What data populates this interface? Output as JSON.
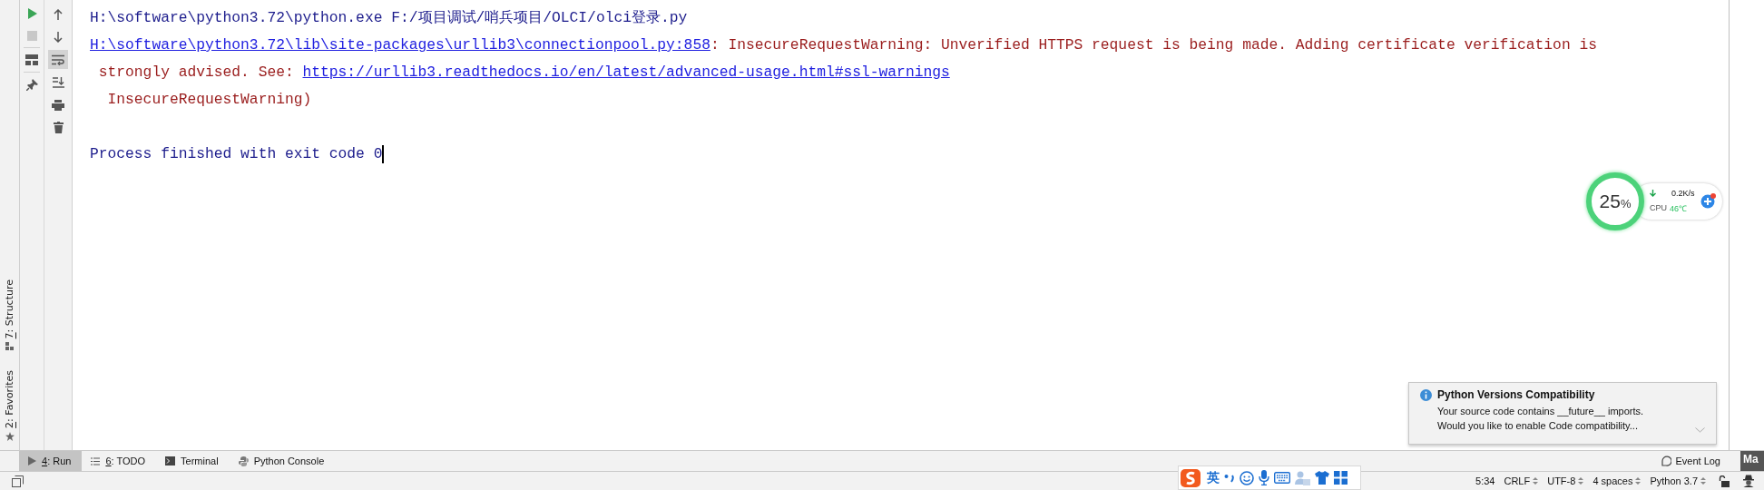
{
  "side_tabs": [
    {
      "mnemonic": "7",
      "label": ": Structure"
    },
    {
      "mnemonic": "2",
      "label": ": Favorites"
    }
  ],
  "run_toolbar": [
    {
      "enabled": true
    },
    {
      "enabled": false
    }
  ],
  "console_toolbar": [
    {
      "selected": false
    },
    {
      "selected": false
    },
    {
      "selected": true
    },
    {
      "selected": false
    },
    {
      "selected": false
    },
    {
      "selected": false
    }
  ],
  "console": {
    "lines": [
      [
        {
          "kind": "plain",
          "text": "H:\\software\\python3.72\\python.exe F:/项目调试/哨兵项目/OLCI/olci登录.py"
        }
      ],
      [
        {
          "kind": "link",
          "text": "H:\\software\\python3.72\\lib\\site-packages\\urllib3\\connectionpool.py:858"
        },
        {
          "kind": "error",
          "text": ": InsecureRequestWarning: Unverified HTTPS request is being made. Adding certificate verification is"
        }
      ],
      [
        {
          "kind": "error",
          "text": " strongly advised. See: "
        },
        {
          "kind": "link",
          "text": "https://urllib3.readthedocs.io/en/latest/advanced-usage.html#ssl-warnings"
        }
      ],
      [
        {
          "kind": "error",
          "text": "  InsecureRequestWarning)"
        }
      ],
      [
        {
          "kind": "plain",
          "text": "Process finished with exit code 0"
        }
      ]
    ],
    "cursor": true
  },
  "monitor": {
    "percent": "25",
    "percent_sign": "%",
    "speed": "0.2K/s",
    "cpu_label": "CPU",
    "cpu_temp": "46℃"
  },
  "notification": {
    "title": "Python Versions Compatibility",
    "lines": [
      "Your source code contains __future__ imports.",
      "Would you like to enable Code compatibility..."
    ]
  },
  "tool_tabs": [
    {
      "mnemonic": "4",
      "label": ": Run",
      "selected": true
    },
    {
      "mnemonic": "6",
      "label": ": TODO",
      "selected": false
    },
    {
      "label": "Terminal",
      "selected": false
    },
    {
      "label": "Python Console",
      "selected": false
    }
  ],
  "event_log": "Event Log",
  "corner_label": "Ma",
  "ime": {
    "mode": "英"
  },
  "status_bar": [
    {
      "text": "5:34",
      "dropdown": false
    },
    {
      "text": "CRLF",
      "dropdown": true
    },
    {
      "text": "UTF-8",
      "dropdown": true
    },
    {
      "text": "4 spaces",
      "dropdown": true
    },
    {
      "text": "Python 3.7",
      "dropdown": true
    }
  ]
}
